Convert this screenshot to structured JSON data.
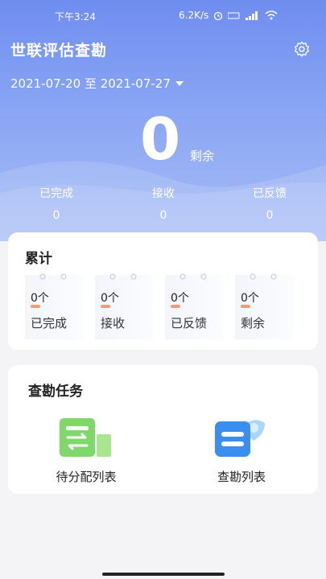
{
  "status": {
    "time": "下午3:24",
    "speed": "6.2K/s"
  },
  "header": {
    "title": "世联评估查勘",
    "date_range": "2021-07-20 至 2021-07-27"
  },
  "summary": {
    "remaining_value": "0",
    "remaining_label": "剩余",
    "stats": [
      {
        "label": "已完成",
        "value": "0"
      },
      {
        "label": "接收",
        "value": "0"
      },
      {
        "label": "已反馈",
        "value": "0"
      }
    ]
  },
  "cumulative": {
    "title": "累计",
    "items": [
      {
        "count": "0个",
        "label": "已完成"
      },
      {
        "count": "0个",
        "label": "接收"
      },
      {
        "count": "0个",
        "label": "已反馈"
      },
      {
        "count": "0个",
        "label": "剩余"
      }
    ]
  },
  "tasks": {
    "title": "查勘任务",
    "items": [
      {
        "label": "待分配列表",
        "icon": "assign-list-icon",
        "color": "#7fd86a"
      },
      {
        "label": "查勘列表",
        "icon": "survey-list-icon",
        "color": "#3a8ef0"
      }
    ]
  }
}
